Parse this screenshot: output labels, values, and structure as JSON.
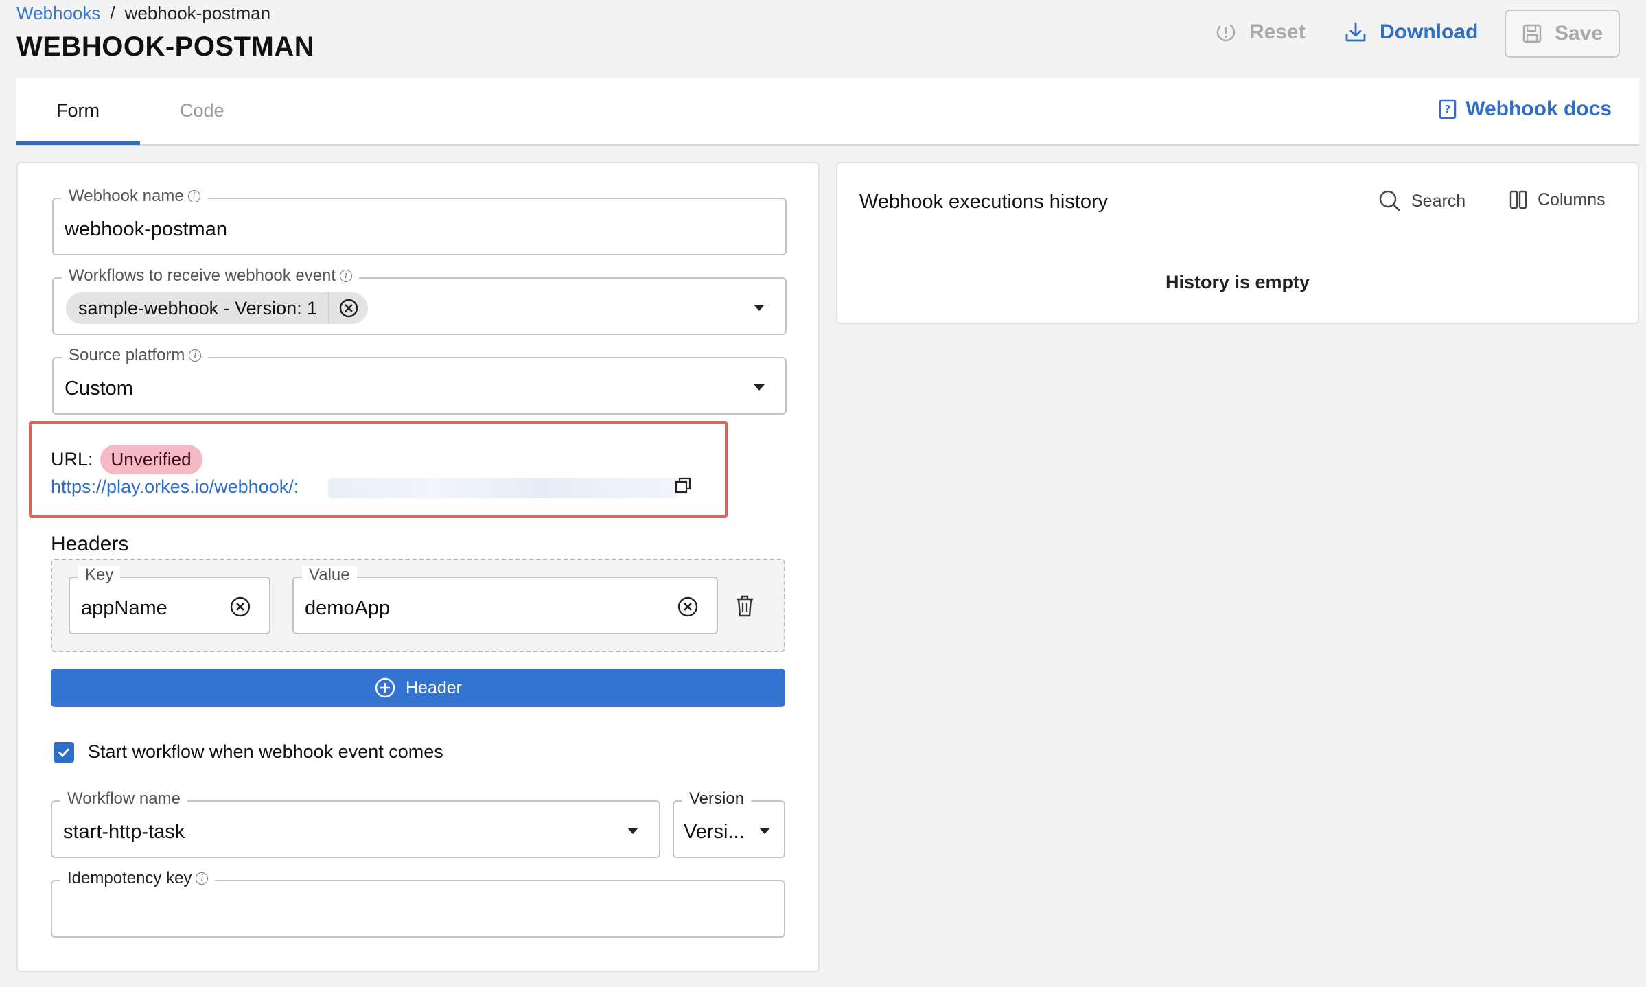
{
  "breadcrumb": {
    "root": "Webhooks",
    "separator": "/",
    "current": "webhook-postman"
  },
  "page_title": "WEBHOOK-POSTMAN",
  "actions": {
    "reset": "Reset",
    "download": "Download",
    "save": "Save"
  },
  "tabs": [
    {
      "label": "Form",
      "active": true
    },
    {
      "label": "Code",
      "active": false
    }
  ],
  "docs_link": "Webhook docs",
  "form": {
    "webhook_name": {
      "label": "Webhook name",
      "value": "webhook-postman"
    },
    "workflows": {
      "label": "Workflows to receive webhook event",
      "chip": "sample-webhook - Version: 1"
    },
    "source_platform": {
      "label": "Source platform",
      "value": "Custom"
    },
    "url": {
      "label": "URL:",
      "status": "Unverified",
      "value": "https://play.orkes.io/webhook/:"
    },
    "headers": {
      "title": "Headers",
      "key_label": "Key",
      "key_value": "appName",
      "value_label": "Value",
      "value_value": "demoApp",
      "add_label": "Header"
    },
    "start_workflow": {
      "label": "Start workflow when webhook event comes",
      "checked": true
    },
    "workflow_name": {
      "label": "Workflow name",
      "value": "start-http-task"
    },
    "version": {
      "label": "Version",
      "value": "Versi..."
    },
    "idempotency": {
      "label": "Idempotency key",
      "value": ""
    }
  },
  "history": {
    "title": "Webhook executions history",
    "search": "Search",
    "columns": "Columns",
    "empty": "History is empty"
  },
  "colors": {
    "accent": "#2f6fc8",
    "button": "#3474d0",
    "badge_bg": "#f4b9c4",
    "highlight_border": "#d9645a"
  }
}
